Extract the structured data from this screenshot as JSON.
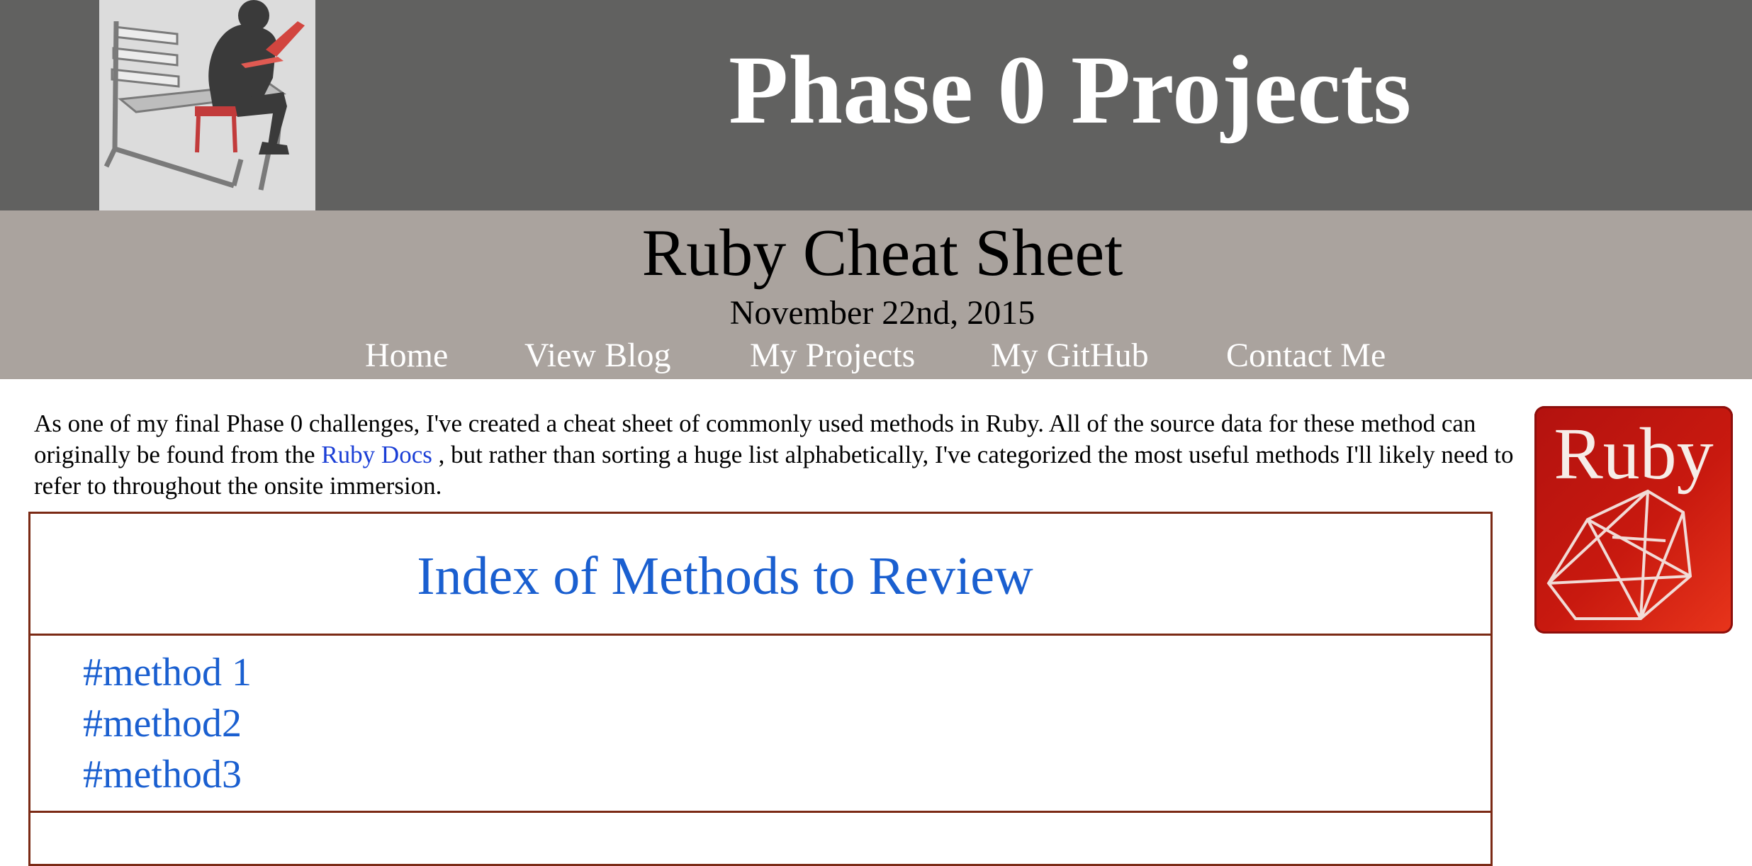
{
  "header": {
    "site_title": "Phase 0 Projects"
  },
  "page": {
    "title": "Ruby Cheat Sheet",
    "date": "November 22nd, 2015"
  },
  "nav": [
    {
      "label": "Home"
    },
    {
      "label": "View Blog"
    },
    {
      "label": "My Projects"
    },
    {
      "label": "My GitHub"
    },
    {
      "label": "Contact Me"
    }
  ],
  "intro": {
    "part1": "As one of my final Phase 0 challenges, I've created a cheat sheet of commonly used methods in Ruby. All of the source data for these method can originally be found from the",
    "link": "Ruby Docs",
    "part2": ", but rather than sorting a huge list alphabetically, I've categorized the most useful methods I'll likely need to refer to throughout the onsite immersion."
  },
  "index": {
    "title": "Index of Methods to Review",
    "items": [
      "#method 1",
      "#method2",
      "#method3"
    ]
  },
  "logo": {
    "text": "Ruby"
  },
  "colors": {
    "header_bg": "#616160",
    "subheader_bg": "#aaa39e",
    "link": "#1a5fd0",
    "border": "#7b2a15",
    "ruby_red": "#c8190f"
  },
  "icons": {
    "header_image": "laptop-man-on-bench-illustration",
    "side_logo": "ruby-gem-logo"
  }
}
